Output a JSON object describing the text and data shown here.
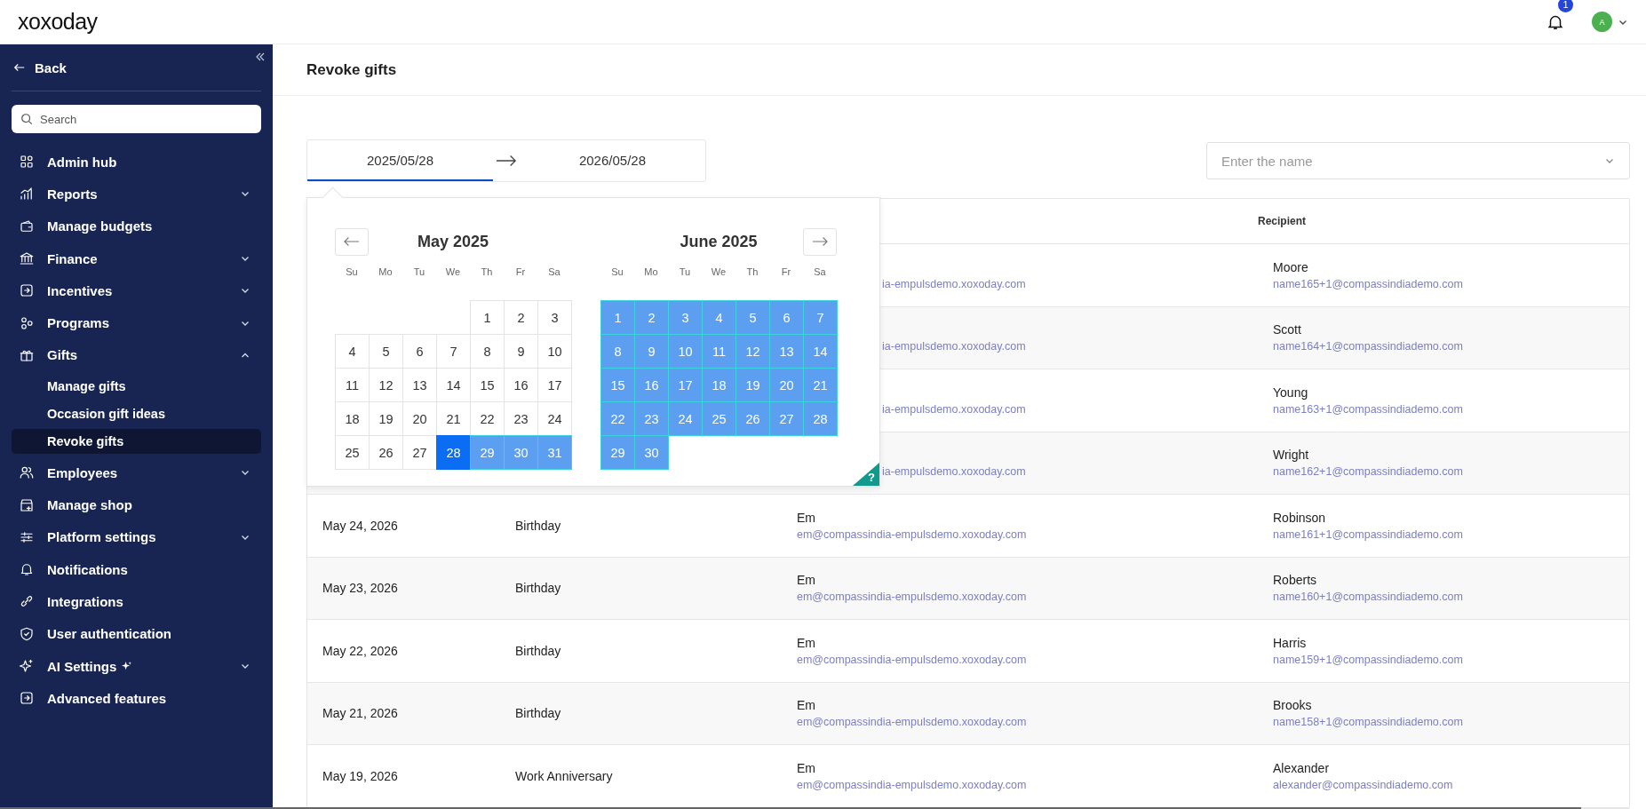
{
  "header": {
    "logo": "xoxoday",
    "notification_count": "1",
    "avatar": "A"
  },
  "sidebar": {
    "back": "Back",
    "search": {
      "placeholder": "Search"
    },
    "items": [
      {
        "label": "Admin hub",
        "selected": false
      },
      {
        "label": "Reports",
        "expanded": false,
        "selected": false
      },
      {
        "label": "Manage budgets",
        "selected": false
      },
      {
        "label": "Finance",
        "expanded": false,
        "selected": false
      },
      {
        "label": "Incentives",
        "expanded": false,
        "selected": false
      },
      {
        "label": "Programs",
        "expanded": false,
        "selected": false
      },
      {
        "label": "Gifts",
        "expanded": true,
        "selected": false,
        "children": [
          {
            "label": "Manage gifts",
            "selected": false
          },
          {
            "label": "Occasion gift ideas",
            "selected": false
          },
          {
            "label": "Revoke gifts",
            "selected": true
          }
        ]
      },
      {
        "label": "Employees",
        "expanded": false,
        "selected": false
      },
      {
        "label": "Manage shop",
        "selected": false
      },
      {
        "label": "Platform settings",
        "expanded": false,
        "selected": false
      },
      {
        "label": "Notifications",
        "selected": false
      },
      {
        "label": "Integrations",
        "selected": false
      },
      {
        "label": "User authentication",
        "selected": false
      },
      {
        "label": "AI Settings",
        "expanded": false,
        "selected": false,
        "sparkle": true
      },
      {
        "label": "Advanced features",
        "selected": false
      }
    ]
  },
  "page": {
    "title": "Revoke gifts"
  },
  "date_range": {
    "start": "2025/05/28",
    "end": "2026/05/28",
    "start_active": true
  },
  "name_filter": {
    "placeholder": "Enter the name"
  },
  "calendar": {
    "help": "?",
    "months": [
      {
        "title": "May 2025",
        "weekdays": [
          "Su",
          "Mo",
          "Tu",
          "We",
          "Th",
          "Fr",
          "Sa"
        ],
        "weeks": [
          {
            "kind": "leading",
            "days": [
              {
                "day": "1",
                "selected": false,
                "in_range": false
              },
              {
                "day": "2",
                "selected": false,
                "in_range": false
              },
              {
                "day": "3",
                "selected": false,
                "in_range": false
              }
            ]
          },
          {
            "kind": "full",
            "days": [
              {
                "day": "4",
                "selected": false,
                "in_range": false
              },
              {
                "day": "5",
                "selected": false,
                "in_range": false
              },
              {
                "day": "6",
                "selected": false,
                "in_range": false
              },
              {
                "day": "7",
                "selected": false,
                "in_range": false
              },
              {
                "day": "8",
                "selected": false,
                "in_range": false
              },
              {
                "day": "9",
                "selected": false,
                "in_range": false
              },
              {
                "day": "10",
                "selected": false,
                "in_range": false
              }
            ]
          },
          {
            "kind": "full",
            "days": [
              {
                "day": "11",
                "selected": false,
                "in_range": false
              },
              {
                "day": "12",
                "selected": false,
                "in_range": false
              },
              {
                "day": "13",
                "selected": false,
                "in_range": false
              },
              {
                "day": "14",
                "selected": false,
                "in_range": false
              },
              {
                "day": "15",
                "selected": false,
                "in_range": false
              },
              {
                "day": "16",
                "selected": false,
                "in_range": false
              },
              {
                "day": "17",
                "selected": false,
                "in_range": false
              }
            ]
          },
          {
            "kind": "full",
            "days": [
              {
                "day": "18",
                "selected": false,
                "in_range": false
              },
              {
                "day": "19",
                "selected": false,
                "in_range": false
              },
              {
                "day": "20",
                "selected": false,
                "in_range": false
              },
              {
                "day": "21",
                "selected": false,
                "in_range": false
              },
              {
                "day": "22",
                "selected": false,
                "in_range": false
              },
              {
                "day": "23",
                "selected": false,
                "in_range": false
              },
              {
                "day": "24",
                "selected": false,
                "in_range": false
              }
            ]
          },
          {
            "kind": "full",
            "days": [
              {
                "day": "25",
                "selected": false,
                "in_range": false
              },
              {
                "day": "26",
                "selected": false,
                "in_range": false
              },
              {
                "day": "27",
                "selected": false,
                "in_range": false
              },
              {
                "day": "28",
                "selected": true
              },
              {
                "day": "29",
                "selected": false,
                "in_range": true
              },
              {
                "day": "30",
                "selected": false,
                "in_range": true
              },
              {
                "day": "31",
                "selected": false,
                "in_range": true
              }
            ]
          }
        ]
      },
      {
        "title": "June 2025",
        "weekdays": [
          "Su",
          "Mo",
          "Tu",
          "We",
          "Th",
          "Fr",
          "Sa"
        ],
        "weeks": [
          {
            "kind": "full",
            "days": [
              {
                "day": "1",
                "selected": false,
                "in_range": true
              },
              {
                "day": "2",
                "selected": false,
                "in_range": true
              },
              {
                "day": "3",
                "selected": false,
                "in_range": true
              },
              {
                "day": "4",
                "selected": false,
                "in_range": true
              },
              {
                "day": "5",
                "selected": false,
                "in_range": true
              },
              {
                "day": "6",
                "selected": false,
                "in_range": true
              },
              {
                "day": "7",
                "selected": false,
                "in_range": true
              }
            ]
          },
          {
            "kind": "full",
            "days": [
              {
                "day": "8",
                "selected": false,
                "in_range": true
              },
              {
                "day": "9",
                "selected": false,
                "in_range": true
              },
              {
                "day": "10",
                "selected": false,
                "in_range": true
              },
              {
                "day": "11",
                "selected": false,
                "in_range": true
              },
              {
                "day": "12",
                "selected": false,
                "in_range": true
              },
              {
                "day": "13",
                "selected": false,
                "in_range": true
              },
              {
                "day": "14",
                "selected": false,
                "in_range": true
              }
            ]
          },
          {
            "kind": "full",
            "days": [
              {
                "day": "15",
                "selected": false,
                "in_range": true
              },
              {
                "day": "16",
                "selected": false,
                "in_range": true
              },
              {
                "day": "17",
                "selected": false,
                "in_range": true
              },
              {
                "day": "18",
                "selected": false,
                "in_range": true
              },
              {
                "day": "19",
                "selected": false,
                "in_range": true
              },
              {
                "day": "20",
                "selected": false,
                "in_range": true
              },
              {
                "day": "21",
                "selected": false,
                "in_range": true
              }
            ]
          },
          {
            "kind": "full",
            "days": [
              {
                "day": "22",
                "selected": false,
                "in_range": true
              },
              {
                "day": "23",
                "selected": false,
                "in_range": true
              },
              {
                "day": "24",
                "selected": false,
                "in_range": true
              },
              {
                "day": "25",
                "selected": false,
                "in_range": true
              },
              {
                "day": "26",
                "selected": false,
                "in_range": true
              },
              {
                "day": "27",
                "selected": false,
                "in_range": true
              },
              {
                "day": "28",
                "selected": false,
                "in_range": true
              }
            ]
          },
          {
            "kind": "trailing",
            "days": [
              {
                "day": "29",
                "selected": false,
                "in_range": true
              },
              {
                "day": "30",
                "selected": false,
                "in_range": true
              }
            ]
          }
        ]
      }
    ]
  },
  "table": {
    "recipient_heading": "Recipient",
    "rows": [
      {
        "sender_email": "ia-empulsdemo.xoxoday.com",
        "recipient_name": "Moore",
        "recipient_email": "name165+1@compassindiademo.com"
      },
      {
        "sender_email": "ia-empulsdemo.xoxoday.com",
        "recipient_name": "Scott",
        "recipient_email": "name164+1@compassindiademo.com"
      },
      {
        "sender_email": "ia-empulsdemo.xoxoday.com",
        "recipient_name": "Young",
        "recipient_email": "name163+1@compassindiademo.com"
      },
      {
        "sender_email": "ia-empulsdemo.xoxoday.com",
        "recipient_name": "Wright",
        "recipient_email": "name162+1@compassindiademo.com"
      },
      {
        "date": "May 24, 2026",
        "occasion": "Birthday",
        "sender_name": "Em",
        "sender_email": "em@compassindia-empulsdemo.xoxoday.com",
        "recipient_name": "Robinson",
        "recipient_email": "name161+1@compassindiademo.com"
      },
      {
        "date": "May 23, 2026",
        "occasion": "Birthday",
        "sender_name": "Em",
        "sender_email": "em@compassindia-empulsdemo.xoxoday.com",
        "recipient_name": "Roberts",
        "recipient_email": "name160+1@compassindiademo.com"
      },
      {
        "date": "May 22, 2026",
        "occasion": "Birthday",
        "sender_name": "Em",
        "sender_email": "em@compassindia-empulsdemo.xoxoday.com",
        "recipient_name": "Harris",
        "recipient_email": "name159+1@compassindiademo.com"
      },
      {
        "date": "May 21, 2026",
        "occasion": "Birthday",
        "sender_name": "Em",
        "sender_email": "em@compassindia-empulsdemo.xoxoday.com",
        "recipient_name": "Brooks",
        "recipient_email": "name158+1@compassindiademo.com"
      },
      {
        "date": "May 19, 2026",
        "occasion": "Work Anniversary",
        "sender_name": "Em",
        "sender_email": "em@compassindia-empulsdemo.xoxoday.com",
        "recipient_name": "Alexander",
        "recipient_email": "alexander@compassindiademo.com"
      }
    ]
  }
}
